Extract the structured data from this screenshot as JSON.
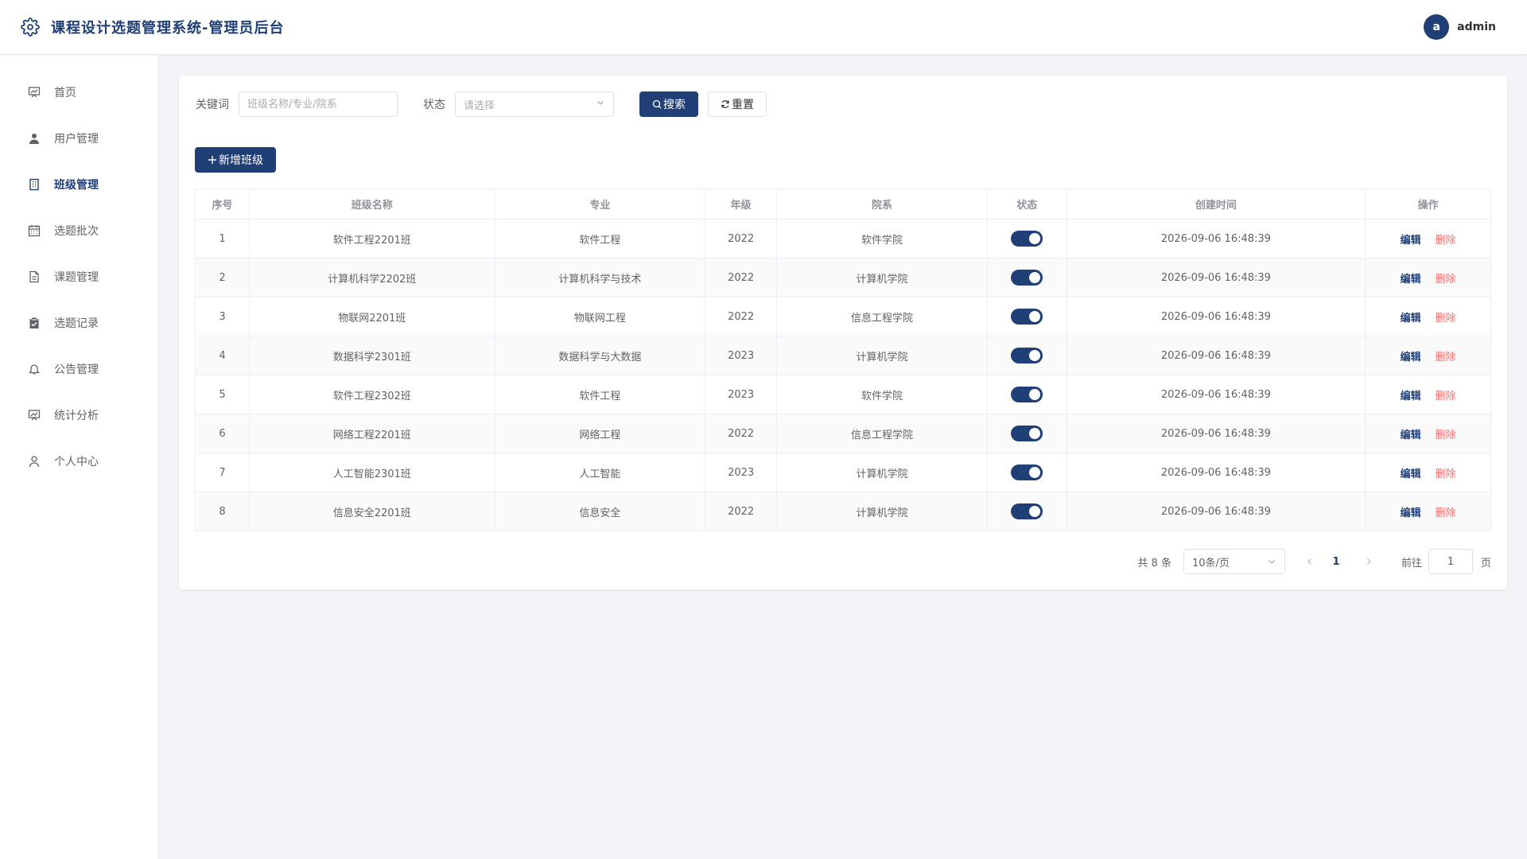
{
  "header": {
    "title": "课程设计选题管理系统-管理员后台",
    "avatar_letter": "a",
    "username": "admin"
  },
  "sidebar": {
    "items": [
      {
        "label": "首页",
        "icon": "dashboard-icon"
      },
      {
        "label": "用户管理",
        "icon": "user-icon"
      },
      {
        "label": "班级管理",
        "icon": "building-icon",
        "active": true
      },
      {
        "label": "选题批次",
        "icon": "calendar-icon"
      },
      {
        "label": "课题管理",
        "icon": "document-icon"
      },
      {
        "label": "选题记录",
        "icon": "clipboard-check-icon"
      },
      {
        "label": "公告管理",
        "icon": "bell-icon"
      },
      {
        "label": "统计分析",
        "icon": "chart-icon"
      },
      {
        "label": "个人中心",
        "icon": "user-outline-icon"
      }
    ]
  },
  "search": {
    "keyword_label": "关键词",
    "keyword_placeholder": "班级名称/专业/院系",
    "keyword_value": "",
    "status_label": "状态",
    "status_placeholder": "请选择",
    "search_button": "搜索",
    "reset_button": "重置"
  },
  "toolbar": {
    "add_button": "新增班级"
  },
  "table": {
    "columns": [
      "序号",
      "班级名称",
      "专业",
      "年级",
      "院系",
      "状态",
      "创建时间",
      "操作"
    ],
    "rows": [
      {
        "no": "1",
        "name": "软件工程2201班",
        "major": "软件工程",
        "grade": "2022",
        "dept": "软件学院",
        "enabled": true,
        "created": "2026-09-06 16:48:39"
      },
      {
        "no": "2",
        "name": "计算机科学2202班",
        "major": "计算机科学与技术",
        "grade": "2022",
        "dept": "计算机学院",
        "enabled": true,
        "created": "2026-09-06 16:48:39"
      },
      {
        "no": "3",
        "name": "物联网2201班",
        "major": "物联网工程",
        "grade": "2022",
        "dept": "信息工程学院",
        "enabled": true,
        "created": "2026-09-06 16:48:39"
      },
      {
        "no": "4",
        "name": "数据科学2301班",
        "major": "数据科学与大数据",
        "grade": "2023",
        "dept": "计算机学院",
        "enabled": true,
        "created": "2026-09-06 16:48:39"
      },
      {
        "no": "5",
        "name": "软件工程2302班",
        "major": "软件工程",
        "grade": "2023",
        "dept": "软件学院",
        "enabled": true,
        "created": "2026-09-06 16:48:39"
      },
      {
        "no": "6",
        "name": "网络工程2201班",
        "major": "网络工程",
        "grade": "2022",
        "dept": "信息工程学院",
        "enabled": true,
        "created": "2026-09-06 16:48:39"
      },
      {
        "no": "7",
        "name": "人工智能2301班",
        "major": "人工智能",
        "grade": "2023",
        "dept": "计算机学院",
        "enabled": true,
        "created": "2026-09-06 16:48:39"
      },
      {
        "no": "8",
        "name": "信息安全2201班",
        "major": "信息安全",
        "grade": "2022",
        "dept": "计算机学院",
        "enabled": true,
        "created": "2026-09-06 16:48:39"
      }
    ],
    "edit_label": "编辑",
    "delete_label": "删除"
  },
  "pagination": {
    "total_text": "共 8 条",
    "page_size": "10条/页",
    "current_page": "1",
    "goto_label": "前往",
    "goto_value": "1",
    "page_suffix": "页"
  },
  "colors": {
    "primary": "#1f3f76",
    "danger": "#f56c6c"
  }
}
